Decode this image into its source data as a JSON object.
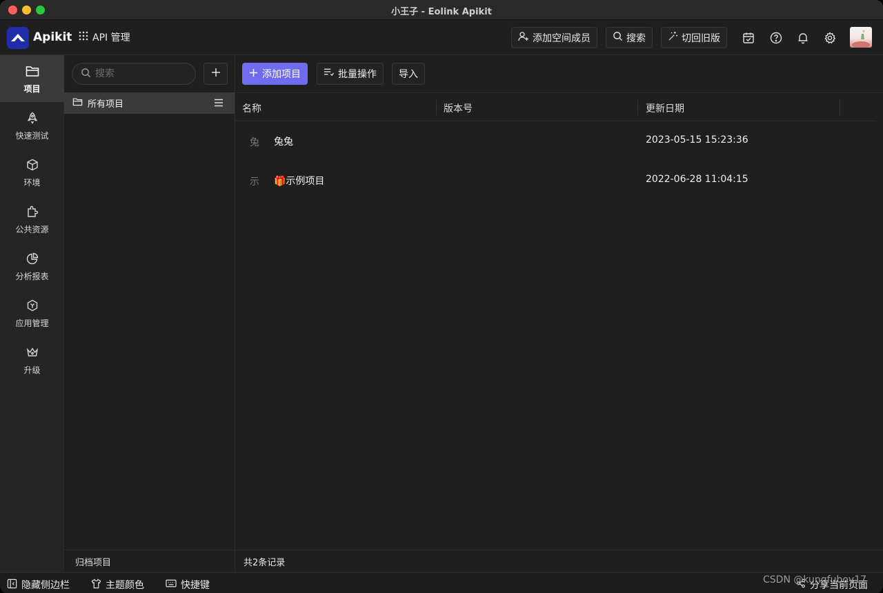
{
  "window": {
    "title": "小王子 - Eolink Apikit"
  },
  "header": {
    "logo_text": "Apikit",
    "app_menu_label": "API 管理",
    "add_member_label": "添加空间成员",
    "search_label": "搜索",
    "switch_label": "切回旧版"
  },
  "rail": {
    "items": [
      {
        "label": "项目",
        "icon": "folder-icon"
      },
      {
        "label": "快速测试",
        "icon": "rocket-icon"
      },
      {
        "label": "环境",
        "icon": "cube-icon"
      },
      {
        "label": "公共资源",
        "icon": "puzzle-icon"
      },
      {
        "label": "分析报表",
        "icon": "pie-chart-icon"
      },
      {
        "label": "应用管理",
        "icon": "app-hex-icon"
      },
      {
        "label": "升级",
        "icon": "crown-icon"
      }
    ]
  },
  "tree": {
    "search_placeholder": "搜索",
    "root_label": "所有项目",
    "footer_label": "归档项目"
  },
  "toolbar": {
    "add_project_label": "添加项目",
    "batch_label": "批量操作",
    "import_label": "导入"
  },
  "table": {
    "columns": [
      "名称",
      "版本号",
      "更新日期"
    ],
    "rows": [
      {
        "icon_char": "兔",
        "name": "兔兔",
        "version": "",
        "date": "2023-05-15 15:23:36"
      },
      {
        "icon_char": "示",
        "name": "🎁示例项目",
        "version": "",
        "date": "2022-06-28 11:04:15"
      }
    ],
    "footer": "共2条记录"
  },
  "statusbar": {
    "hide_sidebar": "隐藏侧边栏",
    "theme": "主题颜色",
    "shortcuts": "快捷键",
    "share": "分享当前页面",
    "watermark": "CSDN @kungfuboy17"
  },
  "colors": {
    "primary": "#6f6cf0",
    "logo_bg": "#1f2ea8"
  }
}
